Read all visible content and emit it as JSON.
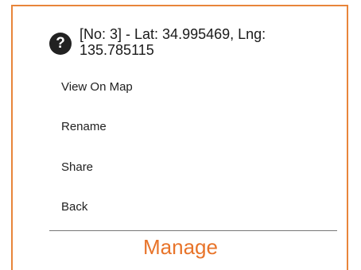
{
  "dialog": {
    "title": "[No: 3] - Lat: 34.995469, Lng: 135.785115",
    "icon": "help-icon",
    "icon_glyph": "?",
    "items": [
      {
        "label": "View On Map"
      },
      {
        "label": "Rename"
      },
      {
        "label": "Share"
      },
      {
        "label": "Back"
      }
    ]
  },
  "caption": "Manage",
  "colors": {
    "accent": "#e8853a",
    "caption": "#e8742a",
    "icon_bg": "#222222"
  }
}
